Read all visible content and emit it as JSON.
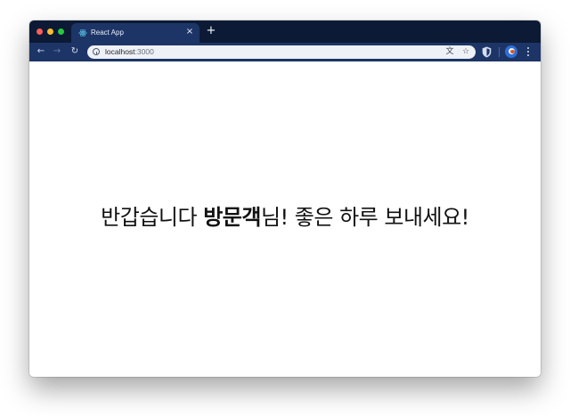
{
  "browser": {
    "tab": {
      "title": "React App",
      "icon": "react-logo-icon",
      "close_glyph": "×"
    },
    "new_tab_glyph": "+",
    "nav": {
      "back_glyph": "←",
      "forward_glyph": "→",
      "reload_glyph": "↻"
    },
    "address": {
      "host": "localhost",
      "port": ":3000"
    },
    "omnibox_icons": {
      "translate_glyph": "文",
      "bookmark_glyph": "☆"
    },
    "extension_icon": "shield-icon",
    "profile_icon": "avatar",
    "menu_icon": "more-vertical-icon"
  },
  "page": {
    "greeting_prefix": "반갑습니다 ",
    "greeting_name": "방문객",
    "greeting_suffix": "님! 좋은 하루 보내세요!"
  },
  "colors": {
    "tabstrip": "#0c1a35",
    "toolbar": "#1d3566",
    "omnibox": "#eef1f6",
    "page_background": "#ffffff",
    "text": "#111111"
  }
}
